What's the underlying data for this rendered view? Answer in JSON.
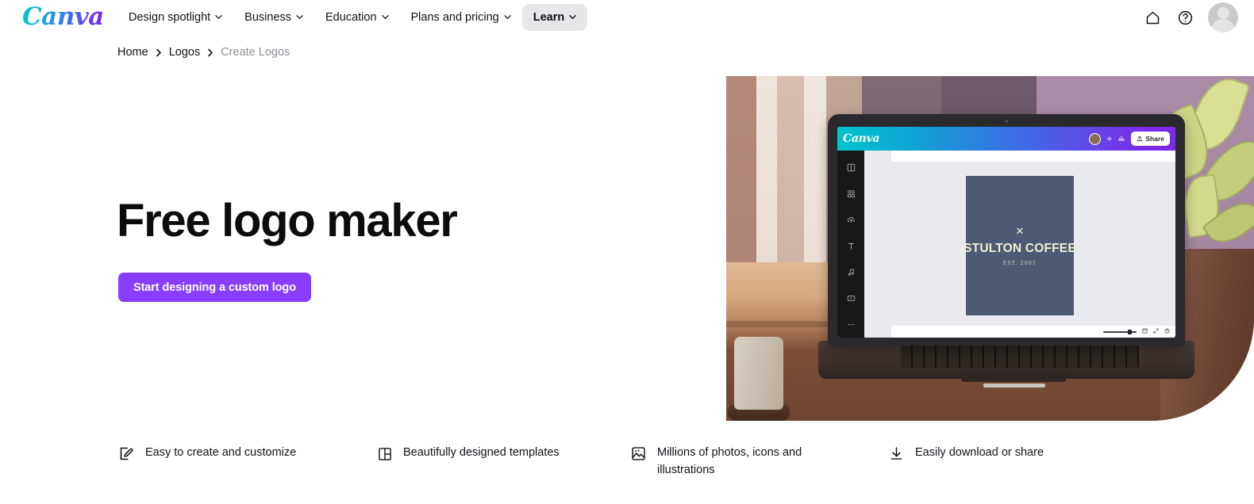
{
  "brand": {
    "name": "Canva"
  },
  "nav": {
    "items": [
      {
        "label": "Design spotlight",
        "has_caret": true,
        "active": false
      },
      {
        "label": "Business",
        "has_caret": true,
        "active": false
      },
      {
        "label": "Education",
        "has_caret": true,
        "active": false
      },
      {
        "label": "Plans and pricing",
        "has_caret": true,
        "active": false
      },
      {
        "label": "Learn",
        "has_caret": true,
        "active": true
      }
    ],
    "right_icons": [
      "home-icon",
      "help-icon",
      "avatar"
    ]
  },
  "breadcrumb": {
    "items": [
      {
        "label": "Home",
        "current": false
      },
      {
        "label": "Logos",
        "current": false
      },
      {
        "label": "Create Logos",
        "current": true
      }
    ],
    "separator": "›"
  },
  "hero": {
    "headline": "Free logo maker",
    "cta_label": "Start designing a custom logo",
    "cta_color": "#8b3dff"
  },
  "hero_image": {
    "editor": {
      "logo": "Canva",
      "share_label": "Share",
      "plus": "+",
      "sidebar_icons": [
        "templates-icon",
        "elements-icon",
        "uploads-icon",
        "text-icon",
        "audio-icon",
        "videos-icon",
        "more-icon"
      ],
      "canvas": {
        "mark": "✕",
        "title": "STULTON COFFEE",
        "subtitle": "EST. 2001",
        "bg_color": "#4c5a74",
        "text_color": "#f7f0cf"
      }
    }
  },
  "features": [
    {
      "icon": "edit-pencil-icon",
      "label": "Easy to create and customize"
    },
    {
      "icon": "templates-layout-icon",
      "label": "Beautifully designed templates"
    },
    {
      "icon": "photo-image-icon",
      "label": "Millions of photos, icons and illustrations"
    },
    {
      "icon": "download-icon",
      "label": "Easily download or share"
    }
  ]
}
